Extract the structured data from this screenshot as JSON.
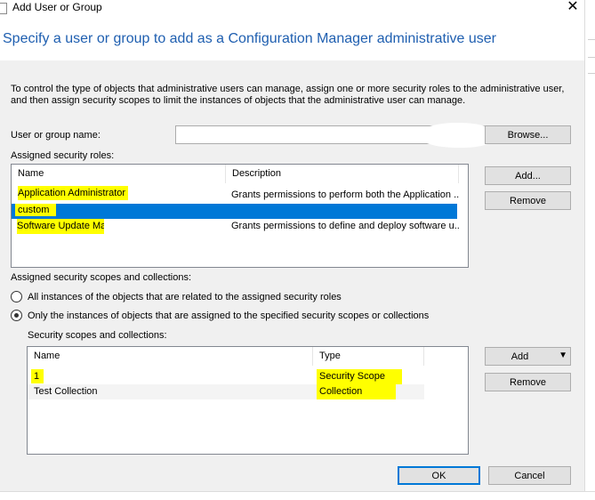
{
  "window": {
    "title": "Add User or Group",
    "close_glyph": "✕"
  },
  "heading": "Specify a user or group to add as a Configuration Manager administrative user",
  "intro_text": "To control the type of objects that administrative users can manage, assign one or more security roles  to the  administrative user, and then assign security scopes to limit the instances of objects that the administrative user can manage.",
  "user_or_group": {
    "label": "User or group name:",
    "value": "",
    "browse_label": "Browse..."
  },
  "roles": {
    "label": "Assigned security roles:",
    "columns": [
      "Name",
      "Description"
    ],
    "rows": [
      {
        "name": "Application Administrator",
        "description": "Grants permissions to perform both the Application ..."
      },
      {
        "name": "custom",
        "description": ""
      },
      {
        "name": "Software Update Manager",
        "description": "Grants permissions to define and deploy software u..."
      }
    ],
    "add_label": "Add...",
    "remove_label": "Remove"
  },
  "scopes": {
    "label": "Assigned security scopes and collections:",
    "option_all": "All instances of the objects that are related to the assigned security roles",
    "option_only": "Only the instances of objects that are assigned to the specified security scopes or collections",
    "list_label": "Security scopes and collections:",
    "columns": [
      "Name",
      "Type"
    ],
    "rows": [
      {
        "name": "1",
        "type": "Security Scope"
      },
      {
        "name": "Test Collection",
        "type": "Collection"
      }
    ],
    "add_label": "Add",
    "add_arrow": "▼",
    "remove_label": "Remove"
  },
  "footer": {
    "ok_label": "OK",
    "cancel_label": "Cancel"
  },
  "colors": {
    "heading": "#1f5fb0",
    "selection": "#0078d7",
    "highlight": "#ffff00"
  }
}
